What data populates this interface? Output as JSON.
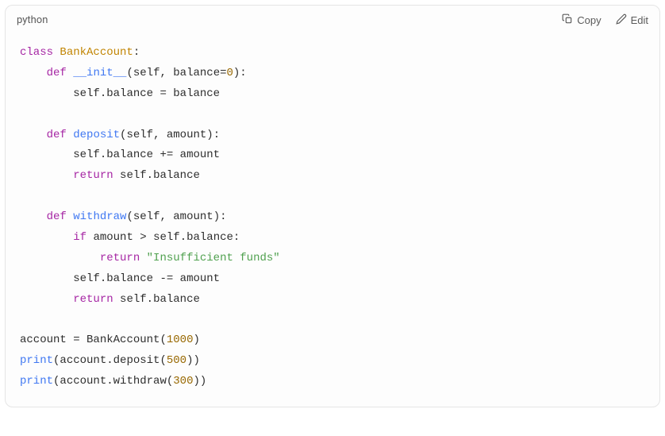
{
  "header": {
    "language": "python",
    "copy_label": "Copy",
    "edit_label": "Edit"
  },
  "code": {
    "kw_class": "class",
    "cls_name": "BankAccount",
    "kw_def": "def",
    "fn_init": "__init__",
    "p_self": "self",
    "p_balance": "balance",
    "num_0": "0",
    "id_self": "self",
    "attr_balance": "balance",
    "fn_deposit": "deposit",
    "p_amount": "amount",
    "kw_return": "return",
    "fn_withdraw": "withdraw",
    "kw_if": "if",
    "str_insufficient": "\"Insufficient funds\"",
    "id_account": "account",
    "num_1000": "1000",
    "fn_print": "print",
    "num_500": "500",
    "num_300": "300",
    "method_deposit": "deposit",
    "method_withdraw": "withdraw"
  }
}
